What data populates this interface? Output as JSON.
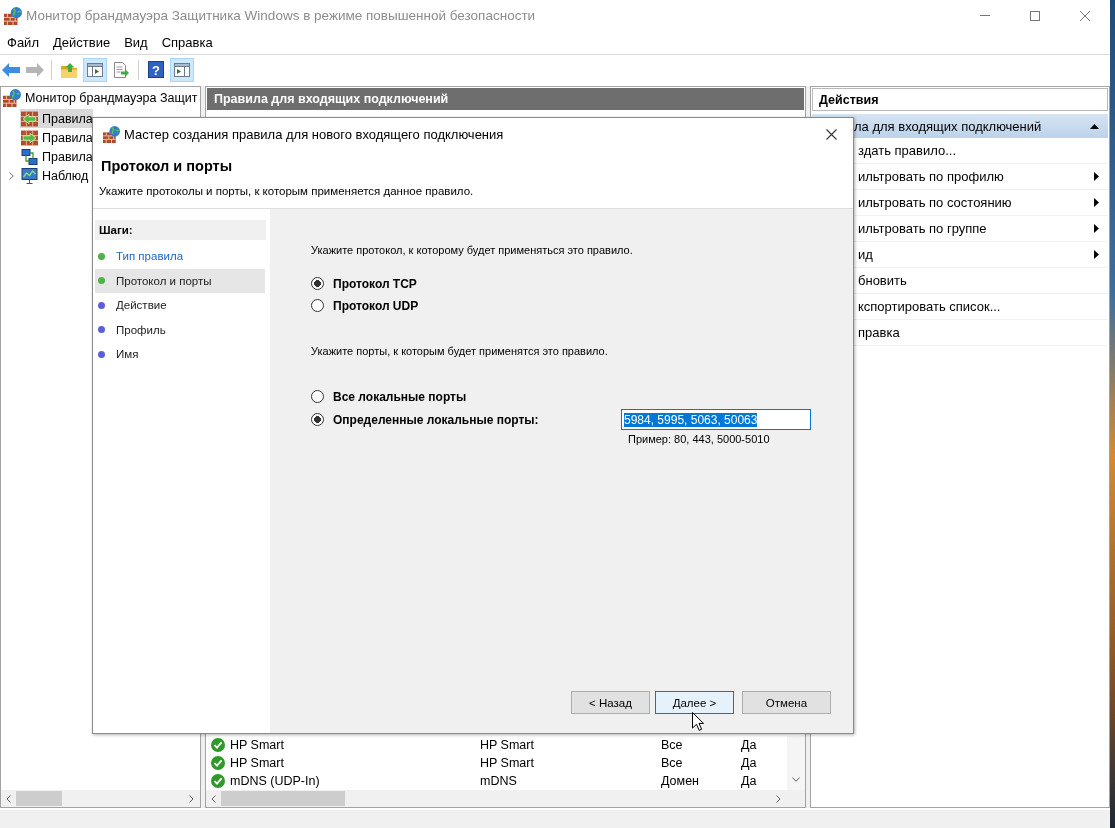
{
  "window": {
    "title": "Монитор брандмауэра Защитника Windows в режиме повышенной безопасности",
    "active": false
  },
  "menu": [
    "Файл",
    "Действие",
    "Вид",
    "Справка"
  ],
  "toolbar": [
    {
      "kind": "back",
      "disabled": false,
      "pressed": false
    },
    {
      "kind": "forward",
      "disabled": true,
      "pressed": false
    },
    {
      "kind": "separator"
    },
    {
      "kind": "up",
      "disabled": false,
      "pressed": false
    },
    {
      "kind": "console-tree",
      "disabled": false,
      "pressed": true
    },
    {
      "kind": "export",
      "disabled": false,
      "pressed": false
    },
    {
      "kind": "separator"
    },
    {
      "kind": "help",
      "disabled": false,
      "pressed": false,
      "glyph": "?"
    },
    {
      "kind": "action-pane",
      "disabled": false,
      "pressed": true
    }
  ],
  "tree": [
    {
      "label": "Монитор брандмауэра Защит",
      "kind": "firewall",
      "selected": false,
      "children": [
        {
          "label": "Правила",
          "kind": "inbound",
          "selected": true
        },
        {
          "label": "Правила",
          "kind": "outbound",
          "selected": false
        },
        {
          "label": "Правила",
          "kind": "security",
          "selected": false
        },
        {
          "label": "Наблюд",
          "kind": "monitoring",
          "selected": false,
          "expanded": false
        }
      ]
    }
  ],
  "rules": {
    "title": "Правила для входящих подключений",
    "rows": [
      {
        "enabled": true,
        "cells": [
          "HP Smart",
          "HP Smart",
          "Все",
          "Да"
        ]
      },
      {
        "enabled": true,
        "cells": [
          "HP Smart",
          "HP Smart",
          "Все",
          "Да"
        ]
      },
      {
        "enabled": true,
        "cells": [
          "mDNS (UDP-In)",
          "mDNS",
          "Домен",
          "Да"
        ]
      }
    ]
  },
  "actions": {
    "title": "Действия",
    "section": {
      "title": "ла для входящих подключений",
      "expanded": true
    },
    "items": [
      {
        "label": "здать правило...",
        "submenu": false
      },
      {
        "label": "ильтровать по профилю",
        "submenu": true
      },
      {
        "label": "ильтровать по состоянию",
        "submenu": true
      },
      {
        "label": "ильтровать по группе",
        "submenu": true
      },
      {
        "label": "ид",
        "submenu": true
      },
      {
        "label": "бновить",
        "submenu": false
      },
      {
        "label": "кспортировать список...",
        "submenu": false
      },
      {
        "label": "правка",
        "submenu": false
      }
    ]
  },
  "wizard": {
    "title": "Мастер создания правила для нового входящего подключения",
    "heading": "Протокол и порты",
    "description": "Укажите протоколы и порты, к которым применяется данное правило.",
    "steps_title": "Шаги:",
    "steps": [
      {
        "label": "Тип правила",
        "selected": false,
        "link": true,
        "color": "#4db34a"
      },
      {
        "label": "Протокол и порты",
        "selected": true,
        "link": false,
        "color": "#4db34a"
      },
      {
        "label": "Действие",
        "selected": false,
        "link": false,
        "color": "#5b5fd6"
      },
      {
        "label": "Профиль",
        "selected": false,
        "link": false,
        "color": "#5b5fd6"
      },
      {
        "label": "Имя",
        "selected": false,
        "link": false,
        "color": "#5b5fd6"
      }
    ],
    "protocol_prompt": "Укажите протокол, к которому будет применяться это правило.",
    "protocols": [
      {
        "label": "Протокол TCP",
        "selected": true
      },
      {
        "label": "Протокол UDP",
        "selected": false
      }
    ],
    "ports_prompt": "Укажите порты, к которым будет применятся это правило.",
    "port_options": [
      {
        "label": "Все локальные порты",
        "selected": false
      },
      {
        "label": "Определенные локальные порты:",
        "selected": true,
        "field": {
          "value": "5984, 5995, 5063, 50063",
          "value_selected": true
        },
        "hint": "Пример: 80, 443, 5000-5010"
      }
    ],
    "buttons": [
      {
        "label": "< Назад",
        "default": false
      },
      {
        "label": "Далее >",
        "default": true
      },
      {
        "label": "Отмена",
        "default": false
      }
    ]
  }
}
